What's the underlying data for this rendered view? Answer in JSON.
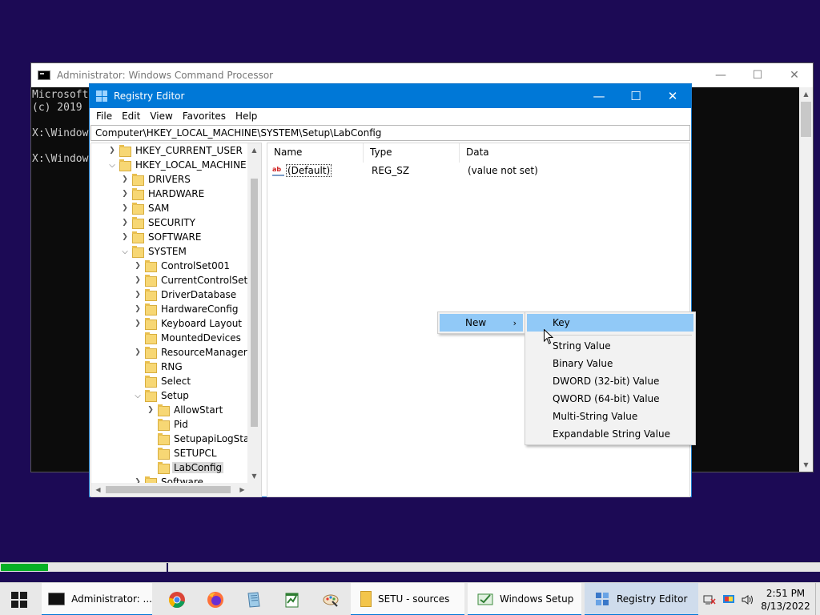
{
  "cmd": {
    "title": "Administrator: Windows Command Processor",
    "lines": [
      "Microsoft",
      "(c) 2019",
      "",
      "X:\\Window",
      "",
      "X:\\Window"
    ]
  },
  "regedit": {
    "title": "Registry Editor",
    "menu": [
      "File",
      "Edit",
      "View",
      "Favorites",
      "Help"
    ],
    "address": "Computer\\HKEY_LOCAL_MACHINE\\SYSTEM\\Setup\\LabConfig",
    "tree": [
      {
        "label": "HKEY_CURRENT_USER",
        "level": 0,
        "expander": "collapsed"
      },
      {
        "label": "HKEY_LOCAL_MACHINE",
        "level": 0,
        "expander": "expanded"
      },
      {
        "label": "DRIVERS",
        "level": 1,
        "expander": "collapsed"
      },
      {
        "label": "HARDWARE",
        "level": 1,
        "expander": "collapsed"
      },
      {
        "label": "SAM",
        "level": 1,
        "expander": "collapsed"
      },
      {
        "label": "SECURITY",
        "level": 1,
        "expander": "collapsed"
      },
      {
        "label": "SOFTWARE",
        "level": 1,
        "expander": "collapsed"
      },
      {
        "label": "SYSTEM",
        "level": 1,
        "expander": "expanded"
      },
      {
        "label": "ControlSet001",
        "level": 2,
        "expander": "collapsed"
      },
      {
        "label": "CurrentControlSet",
        "level": 2,
        "expander": "collapsed"
      },
      {
        "label": "DriverDatabase",
        "level": 2,
        "expander": "collapsed"
      },
      {
        "label": "HardwareConfig",
        "level": 2,
        "expander": "collapsed"
      },
      {
        "label": "Keyboard Layout",
        "level": 2,
        "expander": "collapsed"
      },
      {
        "label": "MountedDevices",
        "level": 2,
        "expander": "none"
      },
      {
        "label": "ResourceManager",
        "level": 2,
        "expander": "collapsed"
      },
      {
        "label": "RNG",
        "level": 2,
        "expander": "none"
      },
      {
        "label": "Select",
        "level": 2,
        "expander": "none"
      },
      {
        "label": "Setup",
        "level": 2,
        "expander": "expanded"
      },
      {
        "label": "AllowStart",
        "level": 3,
        "expander": "collapsed"
      },
      {
        "label": "Pid",
        "level": 3,
        "expander": "none"
      },
      {
        "label": "SetupapiLogStatu",
        "level": 3,
        "expander": "none"
      },
      {
        "label": "SETUPCL",
        "level": 3,
        "expander": "none"
      },
      {
        "label": "LabConfig",
        "level": 3,
        "expander": "none",
        "selected": true
      },
      {
        "label": "Software",
        "level": 2,
        "expander": "collapsed"
      }
    ],
    "columns": [
      "Name",
      "Type",
      "Data"
    ],
    "values": [
      {
        "name": "(Default)",
        "type": "REG_SZ",
        "data": "(value not set)"
      }
    ]
  },
  "context_menu": {
    "new_label": "New",
    "submenu": [
      "Key",
      "String Value",
      "Binary Value",
      "DWORD (32-bit) Value",
      "QWORD (64-bit) Value",
      "Multi-String Value",
      "Expandable String Value"
    ]
  },
  "progress": {
    "fraction": 0.058
  },
  "taskbar": {
    "buttons": [
      {
        "label": "Administrator: ...",
        "icon": "cmd-icon"
      },
      {
        "label": "SETU - sources",
        "icon": "folder-icon"
      },
      {
        "label": "Windows Setup",
        "icon": "setup-icon"
      },
      {
        "label": "Registry Editor",
        "icon": "regedit-icon"
      }
    ],
    "pinned": [
      "chrome-icon",
      "firefox-icon",
      "notepad-icon",
      "spreadsheet-icon",
      "paint-icon"
    ],
    "time": "2:51 PM",
    "date": "8/13/2022"
  },
  "colors": {
    "accent": "#0078d7",
    "desktop": "#1c0a55",
    "menu_highlight": "#91c9f7",
    "progress": "#06b025"
  }
}
